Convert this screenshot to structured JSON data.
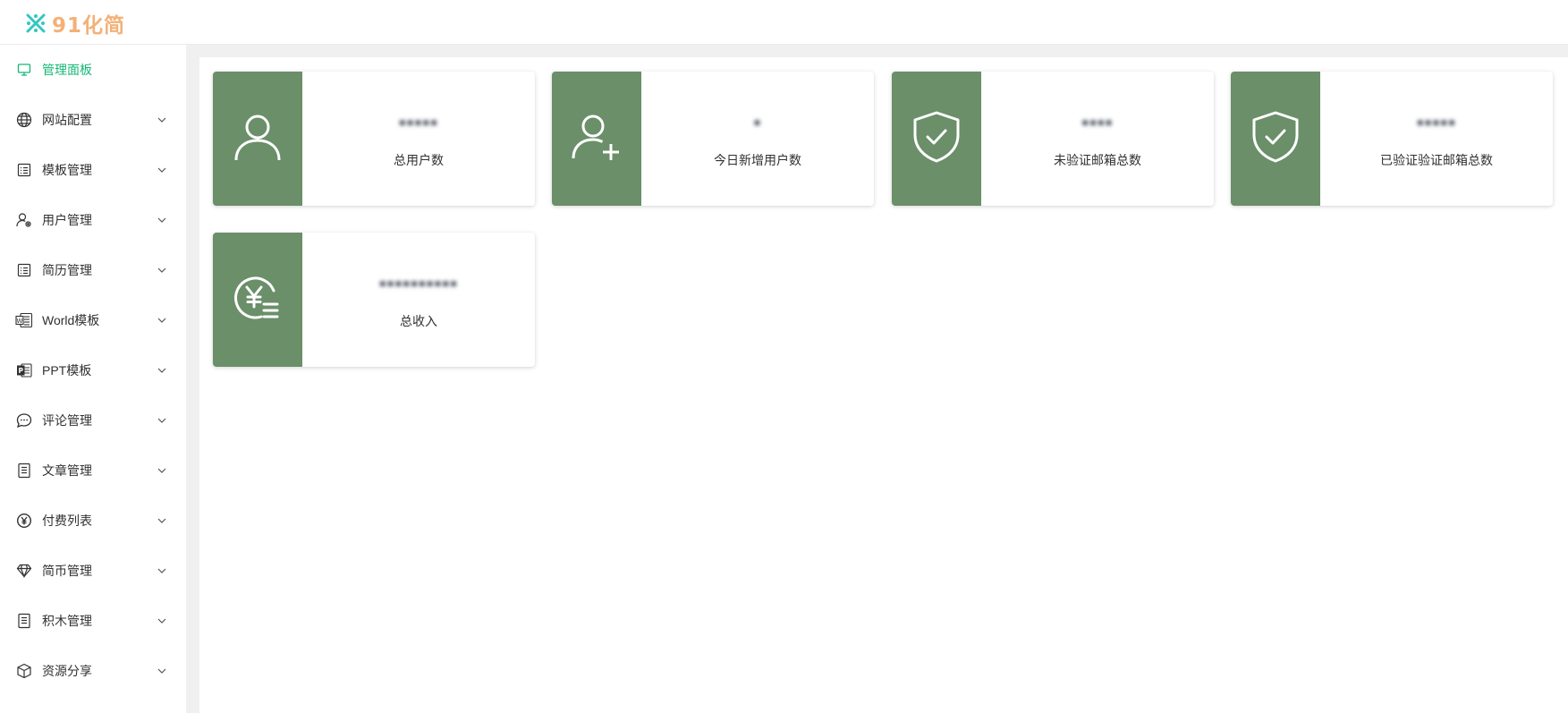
{
  "brand": {
    "name": "91化简",
    "icon": "snowflake-cross-icon",
    "colors": {
      "mark": "#34c6c0",
      "text": "#f3b178"
    }
  },
  "colors": {
    "accent": "#16b777",
    "card_icon_bg": "#6a8f69"
  },
  "sidebar": {
    "items": [
      {
        "label": "管理面板",
        "icon": "monitor-icon",
        "active": true,
        "expandable": false
      },
      {
        "label": "网站配置",
        "icon": "globe-icon",
        "active": false,
        "expandable": true
      },
      {
        "label": "模板管理",
        "icon": "list-icon",
        "active": false,
        "expandable": true
      },
      {
        "label": "用户管理",
        "icon": "user-settings-icon",
        "active": false,
        "expandable": true
      },
      {
        "label": "简历管理",
        "icon": "list-icon",
        "active": false,
        "expandable": true
      },
      {
        "label": "World模板",
        "icon": "word-doc-icon",
        "active": false,
        "expandable": true
      },
      {
        "label": "PPT模板",
        "icon": "ppt-icon",
        "active": false,
        "expandable": true
      },
      {
        "label": "评论管理",
        "icon": "chat-bubble-icon",
        "active": false,
        "expandable": true
      },
      {
        "label": "文章管理",
        "icon": "document-icon",
        "active": false,
        "expandable": true
      },
      {
        "label": "付费列表",
        "icon": "yen-coin-icon",
        "active": false,
        "expandable": true
      },
      {
        "label": "简币管理",
        "icon": "diamond-icon",
        "active": false,
        "expandable": true
      },
      {
        "label": "积木管理",
        "icon": "document-icon",
        "active": false,
        "expandable": true
      },
      {
        "label": "资源分享",
        "icon": "cube-icon",
        "active": false,
        "expandable": true
      }
    ]
  },
  "cards": [
    {
      "value": "▪▪▪▪▪",
      "label": "总用户数",
      "icon": "user-icon"
    },
    {
      "value": "▪",
      "label": "今日新增用户数",
      "icon": "user-add-icon"
    },
    {
      "value": "▪▪▪▪",
      "label": "未验证邮箱总数",
      "icon": "shield-check-icon"
    },
    {
      "value": "▪▪▪▪▪",
      "label": "已验证验证邮箱总数",
      "icon": "shield-check-icon"
    },
    {
      "value": "▪▪▪▪▪▪▪▪▪▪",
      "label": "总收入",
      "icon": "yen-list-icon"
    }
  ]
}
